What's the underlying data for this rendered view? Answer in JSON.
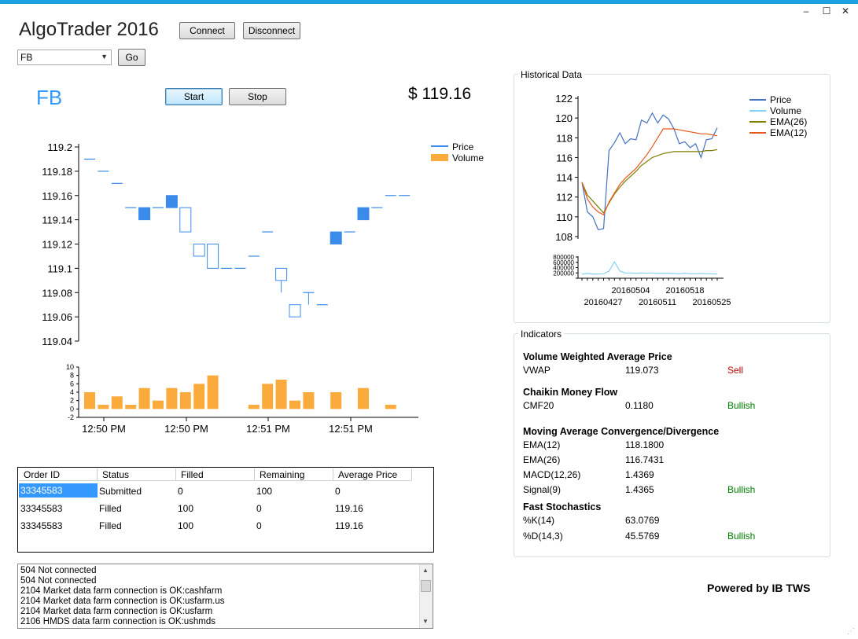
{
  "window": {
    "title": "AlgoTrader 2016",
    "controls": {
      "minimize": "–",
      "maximize": "☐",
      "close": "✕"
    }
  },
  "toolbar": {
    "connect_label": "Connect",
    "disconnect_label": "Disconnect",
    "symbol_select": {
      "value": "FB",
      "options": [
        "FB"
      ]
    },
    "go_label": "Go",
    "start_label": "Start",
    "stop_label": "Stop"
  },
  "quote": {
    "symbol": "FB",
    "price_display": "$ 119.16"
  },
  "colors": {
    "accent": "#1ba1e2",
    "symbol": "#3399ff",
    "candle_up": "#3b8beb",
    "volume": "#fbab3b",
    "price_line": "#4472c4",
    "volume_line": "#86d0f0",
    "ema26_line": "#7f7f00",
    "ema12_line": "#e55a1f",
    "sell": "#c00000",
    "bullish": "#008000"
  },
  "chart_data": [
    {
      "type": "candlestick",
      "title": "",
      "legend": [
        "Price",
        "Volume"
      ],
      "legend_position": "top-right",
      "ylim": [
        119.04,
        119.2
      ],
      "y_ticks": [
        "119.2",
        "119.18",
        "119.16",
        "119.14",
        "119.12",
        "119.1",
        "119.08",
        "119.06",
        "119.04"
      ],
      "x_ticks": [
        "12:50 PM",
        "12:50 PM",
        "12:51 PM",
        "12:51 PM"
      ],
      "candles": [
        {
          "o": 119.19,
          "h": 119.19,
          "l": 119.19,
          "c": 119.19
        },
        {
          "o": 119.18,
          "h": 119.18,
          "l": 119.18,
          "c": 119.18
        },
        {
          "o": 119.17,
          "h": 119.17,
          "l": 119.17,
          "c": 119.17
        },
        {
          "o": 119.15,
          "h": 119.15,
          "l": 119.15,
          "c": 119.15
        },
        {
          "o": 119.14,
          "h": 119.15,
          "l": 119.14,
          "c": 119.15
        },
        {
          "o": 119.15,
          "h": 119.15,
          "l": 119.15,
          "c": 119.15
        },
        {
          "o": 119.15,
          "h": 119.16,
          "l": 119.15,
          "c": 119.16
        },
        {
          "o": 119.15,
          "h": 119.15,
          "l": 119.13,
          "c": 119.13
        },
        {
          "o": 119.12,
          "h": 119.12,
          "l": 119.11,
          "c": 119.11
        },
        {
          "o": 119.12,
          "h": 119.12,
          "l": 119.1,
          "c": 119.1
        },
        {
          "o": 119.1,
          "h": 119.1,
          "l": 119.1,
          "c": 119.1
        },
        {
          "o": 119.1,
          "h": 119.1,
          "l": 119.1,
          "c": 119.1
        },
        {
          "o": 119.11,
          "h": 119.11,
          "l": 119.11,
          "c": 119.11
        },
        {
          "o": 119.13,
          "h": 119.13,
          "l": 119.13,
          "c": 119.13
        },
        {
          "o": 119.1,
          "h": 119.1,
          "l": 119.08,
          "c": 119.09
        },
        {
          "o": 119.07,
          "h": 119.07,
          "l": 119.06,
          "c": 119.06
        },
        {
          "o": 119.08,
          "h": 119.08,
          "l": 119.07,
          "c": 119.08
        },
        {
          "o": 119.07,
          "h": 119.07,
          "l": 119.07,
          "c": 119.07
        },
        {
          "o": 119.12,
          "h": 119.13,
          "l": 119.12,
          "c": 119.13
        },
        {
          "o": 119.13,
          "h": 119.13,
          "l": 119.13,
          "c": 119.13
        },
        {
          "o": 119.14,
          "h": 119.15,
          "l": 119.14,
          "c": 119.15
        },
        {
          "o": 119.15,
          "h": 119.15,
          "l": 119.15,
          "c": 119.15
        },
        {
          "o": 119.16,
          "h": 119.16,
          "l": 119.16,
          "c": 119.16
        },
        {
          "o": 119.16,
          "h": 119.16,
          "l": 119.16,
          "c": 119.16
        }
      ],
      "volume": {
        "ylim": [
          -2,
          10
        ],
        "y_ticks": [
          "10",
          "8",
          "6",
          "4",
          "2",
          "0",
          "-2"
        ],
        "values": [
          4,
          1,
          3,
          1,
          5,
          2,
          5,
          4,
          6,
          8,
          0,
          0,
          1,
          6,
          7,
          2,
          4,
          0,
          4,
          0,
          5,
          0,
          1,
          0
        ]
      }
    },
    {
      "type": "line",
      "title": "Historical Data",
      "legend": [
        "Price",
        "Volume",
        "EMA(26)",
        "EMA(12)"
      ],
      "legend_position": "top-right",
      "ylim": [
        108,
        122
      ],
      "y_ticks": [
        "122",
        "120",
        "118",
        "116",
        "114",
        "112",
        "110",
        "108"
      ],
      "x_ticks_upper": [
        "20160504",
        "20160518"
      ],
      "x_ticks_lower": [
        "20160427",
        "20160511",
        "20160525"
      ],
      "series": [
        {
          "name": "Price",
          "values": [
            113.5,
            110.5,
            110.0,
            108.7,
            108.8,
            116.7,
            117.5,
            118.5,
            117.4,
            117.9,
            117.8,
            119.8,
            119.5,
            120.5,
            119.5,
            120.3,
            119.9,
            118.9,
            117.4,
            117.6,
            117.0,
            117.4,
            116.0,
            117.8,
            117.9,
            119.0
          ]
        },
        {
          "name": "Volume",
          "values": [
            150000,
            180000,
            160000,
            160000,
            170000,
            270000,
            620000,
            270000,
            200000,
            200000,
            190000,
            200000,
            190000,
            200000,
            180000,
            190000,
            190000,
            180000,
            170000,
            190000,
            170000,
            170000,
            180000,
            170000,
            170000,
            160000
          ]
        },
        {
          "name": "EMA(26)",
          "values": [
            113.5,
            112.2,
            111.6,
            111.0,
            110.4,
            111.4,
            112.3,
            113.0,
            113.6,
            114.1,
            114.6,
            115.2,
            115.6,
            116.0,
            116.2,
            116.4,
            116.5,
            116.6,
            116.6,
            116.6,
            116.6,
            116.6,
            116.6,
            116.7,
            116.7,
            116.8
          ]
        },
        {
          "name": "EMA(12)",
          "values": [
            113.5,
            111.8,
            111.0,
            110.5,
            110.2,
            111.5,
            112.4,
            113.3,
            113.9,
            114.4,
            114.9,
            115.6,
            116.3,
            117.1,
            118.0,
            118.9,
            118.9,
            118.9,
            118.8,
            118.7,
            118.6,
            118.5,
            118.4,
            118.4,
            118.3,
            118.2
          ]
        }
      ],
      "volume_axis_ticks": [
        "800000",
        "600000",
        "400000",
        "200000",
        "0"
      ]
    }
  ],
  "historical": {
    "title": "Historical Data"
  },
  "indicators": {
    "title": "Indicators",
    "vwap_section": "Volume Weighted Average Price",
    "vwap": {
      "name": "VWAP",
      "value": "119.073",
      "signal": "Sell"
    },
    "cmf_section": "Chaikin Money Flow",
    "cmf": {
      "name": "CMF20",
      "value": "0.1180",
      "signal": "Bullish"
    },
    "macd_section": "Moving Average Convergence/Divergence",
    "ema12": {
      "name": "EMA(12)",
      "value": "118.1800"
    },
    "ema26": {
      "name": "EMA(26)",
      "value": "116.7431"
    },
    "macd": {
      "name": "MACD(12,26)",
      "value": "1.4369"
    },
    "signal": {
      "name": "Signal(9)",
      "value": "1.4365",
      "signal": "Bullish"
    },
    "stoch_section": "Fast Stochastics",
    "k": {
      "name": "%K(14)",
      "value": "63.0769"
    },
    "d": {
      "name": "%D(14,3)",
      "value": "45.5769",
      "signal": "Bullish"
    }
  },
  "orders": {
    "columns": [
      "Order ID",
      "Status",
      "Filled",
      "Remaining",
      "Average Price"
    ],
    "rows": [
      [
        "33345583",
        "Submitted",
        "0",
        "100",
        "0"
      ],
      [
        "33345583",
        "Filled",
        "100",
        "0",
        "119.16"
      ],
      [
        "33345583",
        "Filled",
        "100",
        "0",
        "119.16"
      ]
    ]
  },
  "log": {
    "lines": [
      "504 Not connected",
      "504 Not connected",
      "2104 Market data farm connection is OK:cashfarm",
      "2104 Market data farm connection is OK:usfarm.us",
      "2104 Market data farm connection is OK:usfarm",
      "2106 HMDS data farm connection is OK:ushmds"
    ]
  },
  "footer": {
    "powered_by": "Powered by IB TWS"
  }
}
